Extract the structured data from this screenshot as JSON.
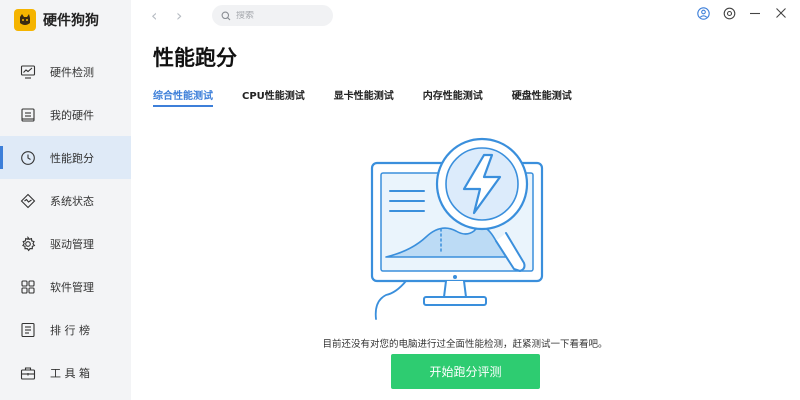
{
  "app": {
    "name": "硬件狗狗",
    "logo_icon": "dog-logo-icon"
  },
  "sidebar": {
    "items": [
      {
        "label": "硬件检测",
        "icon": "monitor-chart-icon",
        "active": false
      },
      {
        "label": "我的硬件",
        "icon": "hardware-box-icon",
        "active": false
      },
      {
        "label": "性能跑分",
        "icon": "speed-gauge-icon",
        "active": true
      },
      {
        "label": "系统状态",
        "icon": "diamond-wave-icon",
        "active": false
      },
      {
        "label": "驱动管理",
        "icon": "gear-icon",
        "active": false
      },
      {
        "label": "软件管理",
        "icon": "apps-grid-icon",
        "active": false
      },
      {
        "label": "排 行 榜",
        "icon": "ranking-icon",
        "active": false
      },
      {
        "label": "工 具 箱",
        "icon": "toolbox-icon",
        "active": false
      }
    ]
  },
  "topbar": {
    "search_placeholder": "搜索"
  },
  "main": {
    "title": "性能跑分",
    "tabs": [
      {
        "label": "综合性能测试",
        "active": true
      },
      {
        "label": "CPU性能测试",
        "active": false
      },
      {
        "label": "显卡性能测试",
        "active": false
      },
      {
        "label": "内存性能测试",
        "active": false
      },
      {
        "label": "硬盘性能测试",
        "active": false
      }
    ],
    "empty_message": "目前还没有对您的电脑进行过全面性能检测，赶紧测试一下看看吧。",
    "start_button": "开始跑分评测"
  },
  "colors": {
    "accent": "#3d7fd9",
    "sidebar_bg": "#f3f4f6",
    "active_bg": "#dfeaf7",
    "button_green": "#2ecc71",
    "illustration_blue": "#3a8fdc"
  }
}
